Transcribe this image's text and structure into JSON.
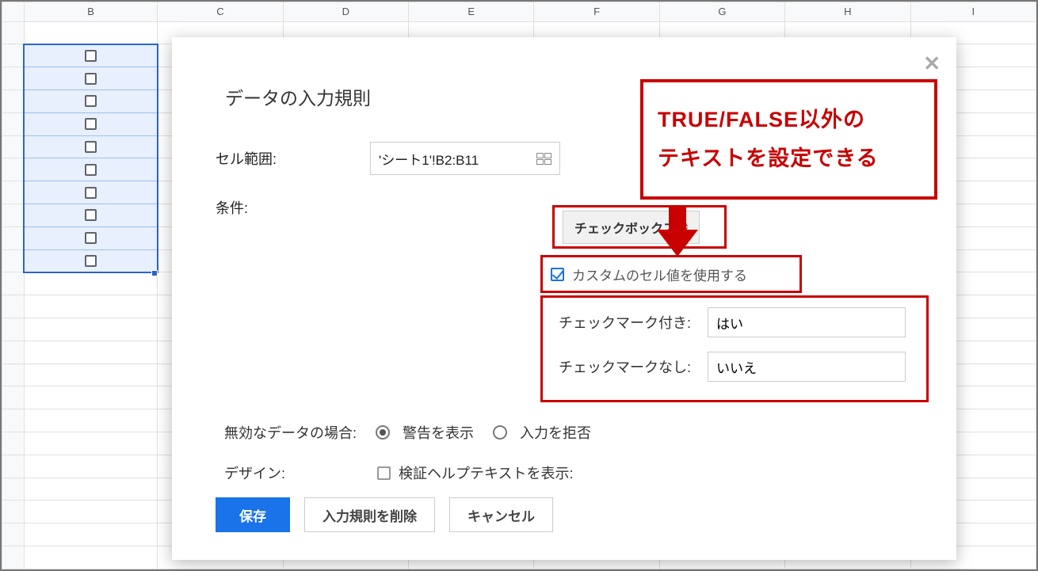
{
  "columns": [
    "B",
    "C",
    "D",
    "E",
    "F",
    "G",
    "H",
    "I"
  ],
  "dialog": {
    "title": "データの入力規則",
    "range_label": "セル範囲:",
    "range_value": "'シート1'!B2:B11",
    "condition_label": "条件:",
    "condition_value": "チェックボックス",
    "custom_label": "カスタムのセル値を使用する",
    "checked_label": "チェックマーク付き:",
    "checked_value": "はい",
    "unchecked_label": "チェックマークなし:",
    "unchecked_value": "いいえ",
    "invalid_label": "無効なデータの場合:",
    "invalid_opt1": "警告を表示",
    "invalid_opt2": "入力を拒否",
    "design_label": "デザイン:",
    "design_opt": "検証ヘルプテキストを表示:",
    "save": "保存",
    "delete": "入力規則を削除",
    "cancel": "キャンセル"
  },
  "callout": {
    "line1": "TRUE/FALSE以外の",
    "line2": "テキストを設定できる"
  }
}
